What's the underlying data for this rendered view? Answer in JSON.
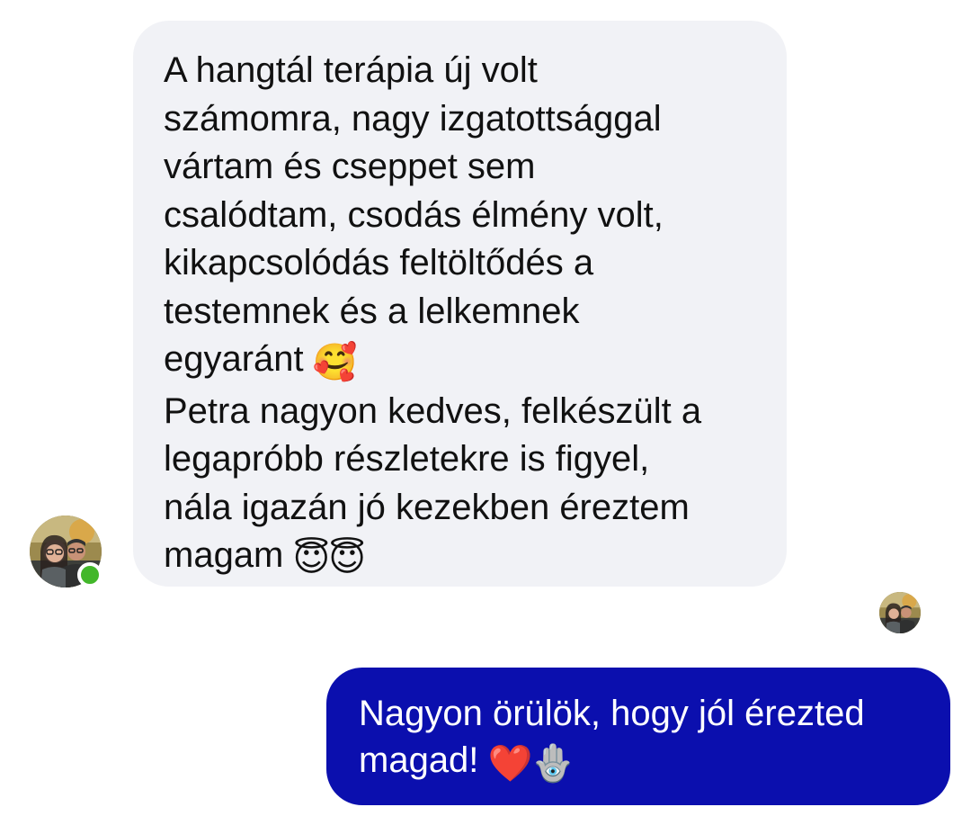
{
  "conversation": {
    "incoming": {
      "lines": [
        "A hangtál terápia új volt",
        "számomra, nagy izgatottsággal",
        "vártam és cseppet sem",
        "csalódtam, csodás élmény volt,",
        "kikapcsolódás feltöltődés a",
        "testemnek és a lelkemnek",
        "egyaránt",
        "Petra nagyon kedves, felkészült a",
        "legapróbb részletekre is figyel,",
        "nála igazán jó kezekben éreztem",
        "magam"
      ],
      "emoji_hearts_face": "🥰",
      "emoji_halo_1": "😇",
      "emoji_halo_2": "😇",
      "online_status": "online",
      "online_color": "#42b72a",
      "bubble_color": "#f1f2f6"
    },
    "outgoing": {
      "lines": [
        "Nagyon örülök, hogy jól érezted",
        "magad!"
      ],
      "emoji_heart": "❤️",
      "emoji_hamsa": "🪬",
      "bubble_color": "#0b0fae",
      "read_receipt": "seen-avatar"
    }
  }
}
